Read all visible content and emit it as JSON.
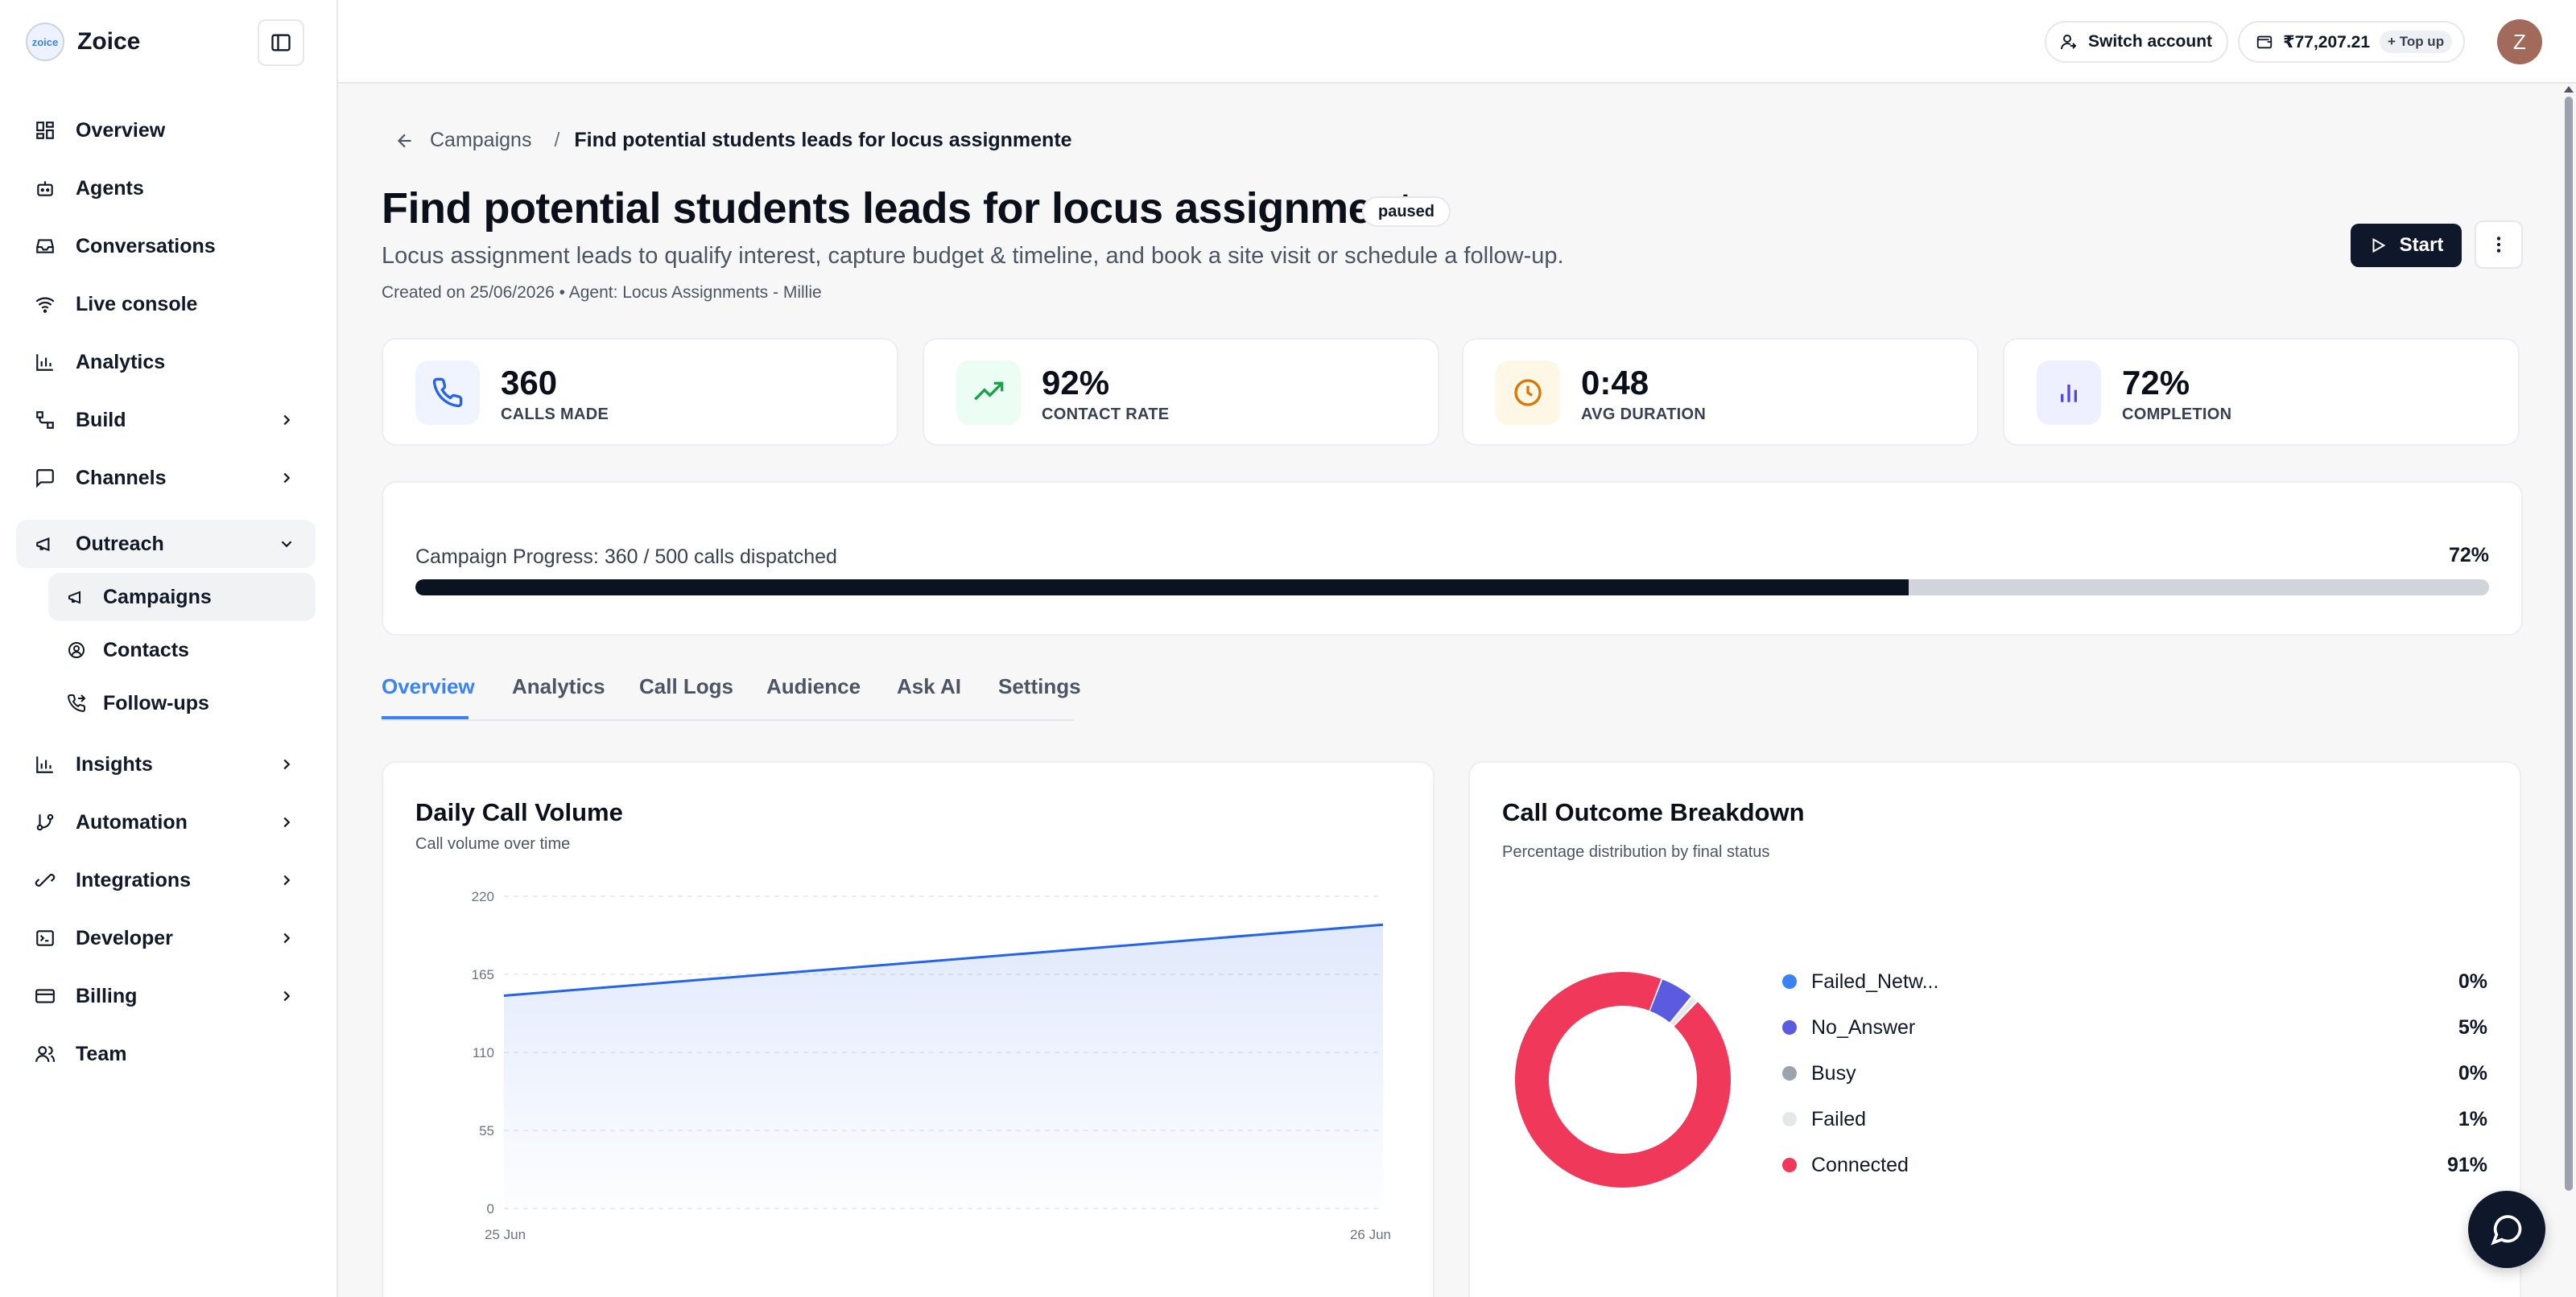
{
  "brand": {
    "name": "Zoice",
    "logo_text": "zoice"
  },
  "sidebar": {
    "items": [
      {
        "label": "Overview",
        "icon": "grid-icon"
      },
      {
        "label": "Agents",
        "icon": "bot-icon"
      },
      {
        "label": "Conversations",
        "icon": "inbox-icon"
      },
      {
        "label": "Live console",
        "icon": "wifi-icon"
      },
      {
        "label": "Analytics",
        "icon": "bar-chart-icon"
      },
      {
        "label": "Build",
        "icon": "workflow-icon"
      },
      {
        "label": "Channels",
        "icon": "message-square-icon"
      },
      {
        "label": "Outreach",
        "icon": "megaphone-icon"
      }
    ],
    "outreach_sub": [
      {
        "label": "Campaigns",
        "icon": "megaphone-icon"
      },
      {
        "label": "Contacts",
        "icon": "contact-icon"
      },
      {
        "label": "Follow-ups",
        "icon": "phone-forwarded-icon"
      }
    ],
    "items_after": [
      {
        "label": "Insights",
        "icon": "bar-chart-icon"
      },
      {
        "label": "Automation",
        "icon": "git-branch-icon"
      },
      {
        "label": "Integrations",
        "icon": "plug-icon"
      },
      {
        "label": "Developer",
        "icon": "terminal-icon"
      },
      {
        "label": "Billing",
        "icon": "credit-card-icon"
      },
      {
        "label": "Team",
        "icon": "users-icon"
      }
    ]
  },
  "topbar": {
    "switch_account": "Switch account",
    "balance": "₹77,207.21",
    "topup": "+ Top up",
    "avatar_initial": "Z"
  },
  "campaign": {
    "breadcrumb_parent": "Campaigns",
    "breadcrumb_separator": "/",
    "breadcrumb_current": "Find potential students leads for locus assignmente",
    "title": "Find potential students leads for locus assignmente",
    "status": "paused",
    "description": "Locus assignment leads to qualify interest, capture budget & timeline, and book a site visit or schedule a follow-up.",
    "meta": "Created on 25/06/2026 • Agent: Locus Assignments - Millie",
    "start_label": "Start"
  },
  "stats": [
    {
      "value": "360",
      "label": "CALLS MADE",
      "icon": "phone-icon",
      "color": "#2563eb",
      "bg": "#eff4ff"
    },
    {
      "value": "92%",
      "label": "CONTACT RATE",
      "icon": "trending-up-icon",
      "color": "#16a34a",
      "bg": "#ecfdf3"
    },
    {
      "value": "0:48",
      "label": "AVG DURATION",
      "icon": "clock-icon",
      "color": "#d97706",
      "bg": "#fff7e6"
    },
    {
      "value": "72%",
      "label": "COMPLETION",
      "icon": "bar-chart-icon",
      "color": "#4f46e5",
      "bg": "#eef0ff"
    }
  ],
  "progress": {
    "label": "Campaign Progress: 360 / 500 calls dispatched",
    "percent_text": "72%",
    "fraction": 0.72
  },
  "tabs": [
    "Overview",
    "Analytics",
    "Call Logs",
    "Audience",
    "Ask AI",
    "Settings"
  ],
  "daily_chart": {
    "title": "Daily Call Volume",
    "subtitle": "Call volume over time"
  },
  "outcome_chart": {
    "title": "Call Outcome Breakdown",
    "subtitle": "Percentage distribution by final status"
  },
  "chart_data": [
    {
      "type": "area",
      "title": "Daily Call Volume",
      "subtitle": "Call volume over time",
      "x": [
        "25 Jun",
        "26 Jun"
      ],
      "series": [
        {
          "values": [
            150,
            200
          ]
        }
      ],
      "yticks": [
        0,
        55,
        110,
        165,
        220
      ],
      "ylim": [
        0,
        220
      ],
      "grid": true,
      "color": "#2563eb"
    },
    {
      "type": "pie",
      "title": "Call Outcome Breakdown",
      "subtitle": "Percentage distribution by final status",
      "labels": [
        "Failed_Netw...",
        "No_Answer",
        "Busy",
        "Failed",
        "Connected"
      ],
      "values": [
        0,
        5,
        0,
        1,
        91
      ],
      "value_labels": [
        "0%",
        "5%",
        "0%",
        "1%",
        "91%"
      ],
      "colors": [
        "#3b82f6",
        "#5b5be0",
        "#9ca3af",
        "#e5e7eb",
        "#f0385a"
      ],
      "legend": "right"
    }
  ]
}
